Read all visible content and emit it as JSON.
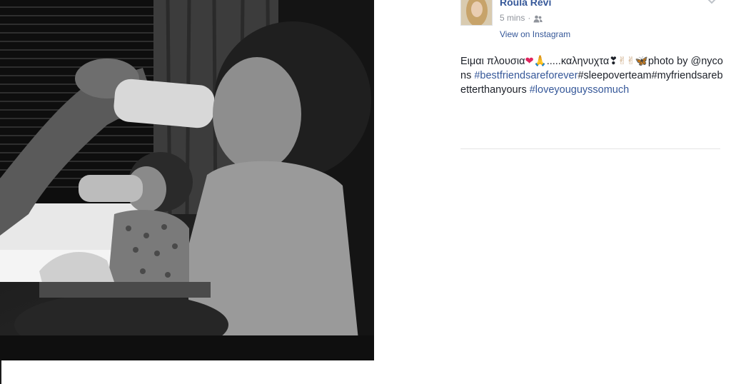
{
  "post": {
    "author": "Roula Revi",
    "time": "5 mins",
    "separator": "·",
    "privacy_icon": "friends-icon",
    "view_link": "View on Instagram",
    "options_icon": "chevron-down-icon",
    "text": {
      "line1_prefix": "Ειμαι πλουσια",
      "emoji1": "❤",
      "emoji2": "🙏",
      "line1_mid": ".....καληνυχτα",
      "emoji3": "❣",
      "emoji4": "✌",
      "emoji5": "✌",
      "emoji6": "🦋",
      "line1_suffix": "photo by",
      "mention": "@nycons",
      "tag1": "#bestfriendsareforever",
      "tag2": "#sleepoverteam",
      "tag3": "#myfriendsarebetterthanyours",
      "tag4": "#loveyouguyssomuch"
    }
  },
  "colors": {
    "link": "#365899",
    "meta": "#90949c",
    "text": "#1d2129"
  }
}
